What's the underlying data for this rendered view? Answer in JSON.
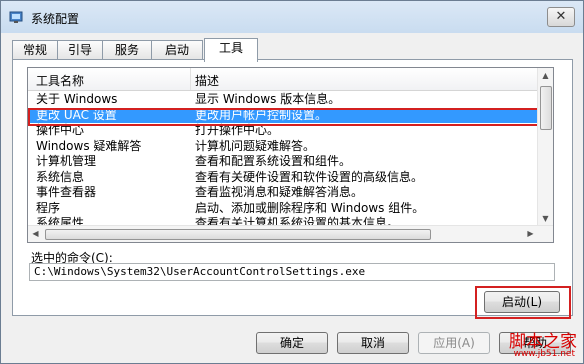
{
  "window": {
    "title": "系统配置",
    "close_label": "✕"
  },
  "tabs": [
    {
      "label": "常规"
    },
    {
      "label": "引导"
    },
    {
      "label": "服务"
    },
    {
      "label": "启动"
    },
    {
      "label": "工具"
    }
  ],
  "active_tab": "工具",
  "list": {
    "headers": {
      "name": "工具名称",
      "desc": "描述"
    },
    "rows": [
      {
        "name": "关于 Windows",
        "desc": "显示 Windows 版本信息。"
      },
      {
        "name": "更改 UAC 设置",
        "desc": "更改用户帐户控制设置。"
      },
      {
        "name": "操作中心",
        "desc": "打开操作中心。"
      },
      {
        "name": "Windows 疑难解答",
        "desc": "计算机问题疑难解答。"
      },
      {
        "name": "计算机管理",
        "desc": "查看和配置系统设置和组件。"
      },
      {
        "name": "系统信息",
        "desc": "查看有关硬件设置和软件设置的高级信息。"
      },
      {
        "name": "事件查看器",
        "desc": "查看监视消息和疑难解答消息。"
      },
      {
        "name": "程序",
        "desc": "启动、添加或删除程序和 Windows 组件。"
      },
      {
        "name": "系统属性",
        "desc": "查看有关计算机系统设置的基本信息。"
      }
    ],
    "selected_row": "更改 UAC 设置"
  },
  "command": {
    "label": "选中的命令(C):",
    "value": "C:\\Windows\\System32\\UserAccountControlSettings.exe"
  },
  "buttons": {
    "launch": "启动(L)",
    "ok": "确定",
    "cancel": "取消",
    "apply": "应用(A)",
    "help": "帮助"
  },
  "watermark": {
    "main": "脚本之家",
    "sub": "www.jb51.net"
  },
  "colors": {
    "selection": "#3399ff",
    "highlight_box": "#d32020",
    "watermark": "#d80000"
  }
}
